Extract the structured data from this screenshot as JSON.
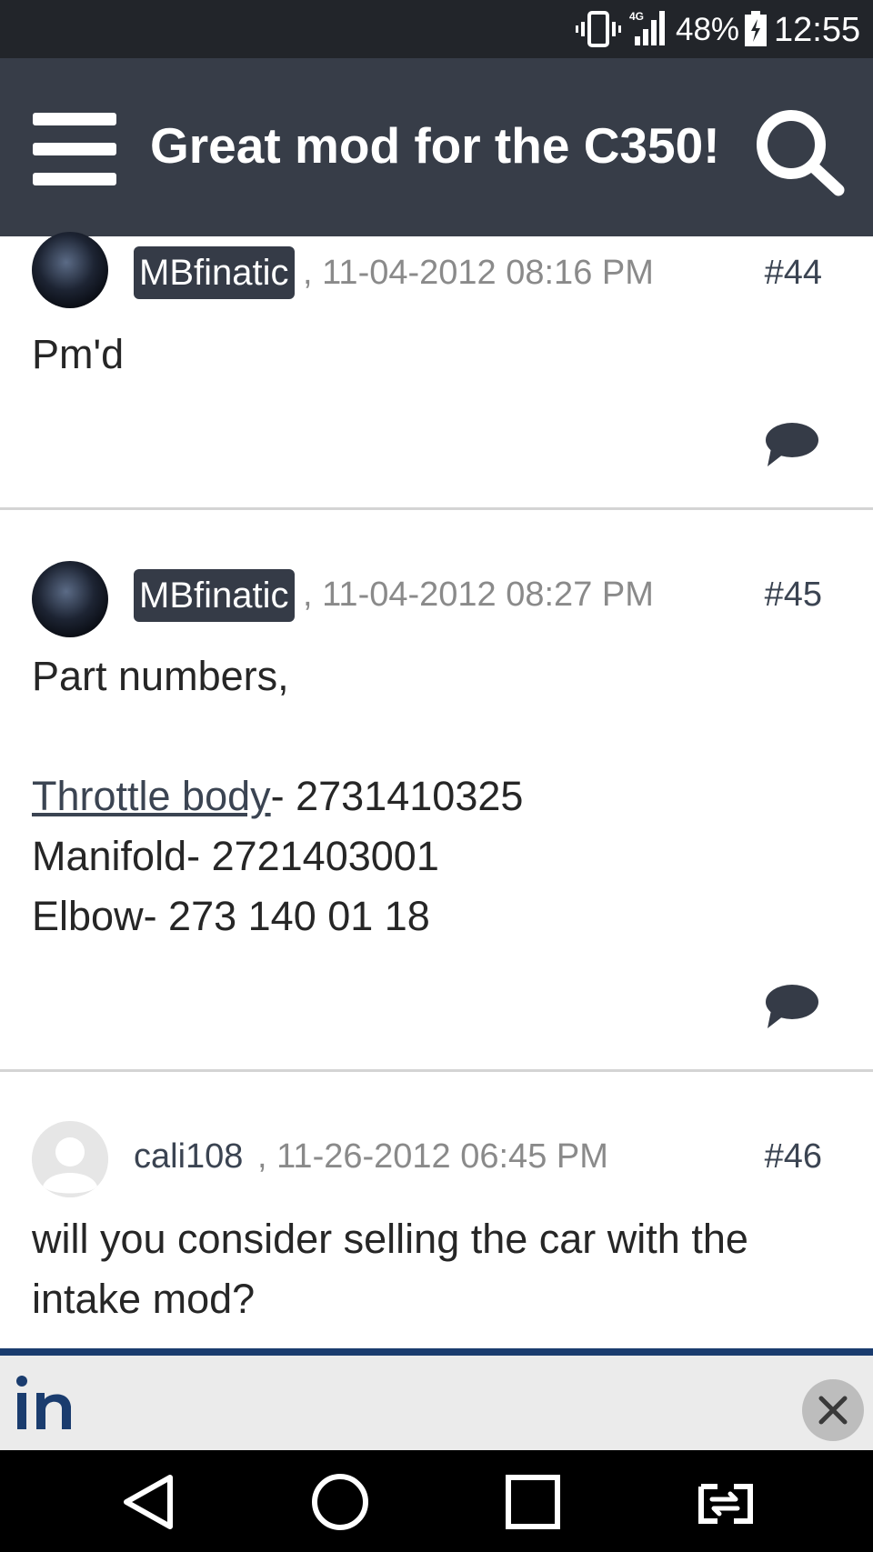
{
  "status_bar": {
    "network": "4G",
    "battery_percent": "48%",
    "time": "12:55"
  },
  "app_bar": {
    "title": "Great mod for the C350!"
  },
  "posts": [
    {
      "username": "MBfinatic",
      "date": ", 11-04-2012 08:16 PM",
      "number": "#44",
      "lines": [
        "Pm'd"
      ]
    },
    {
      "username": "MBfinatic",
      "date": ", 11-04-2012 08:27 PM",
      "number": "#45",
      "lines": [
        "Part numbers,",
        "",
        "- 2731410325",
        "Manifold- 2721403001",
        "Elbow- 273 140 01 18"
      ],
      "link_text": "Throttle body"
    },
    {
      "username": "cali108",
      "date": ", 11-26-2012 06:45 PM",
      "number": "#46",
      "lines": [
        "will you consider selling the car with the",
        "intake mod?"
      ]
    }
  ],
  "colors": {
    "app_bar": "#373d48",
    "status_bar": "#22252a",
    "badge": "#353b47",
    "ad_accent": "#1a3c6e"
  }
}
